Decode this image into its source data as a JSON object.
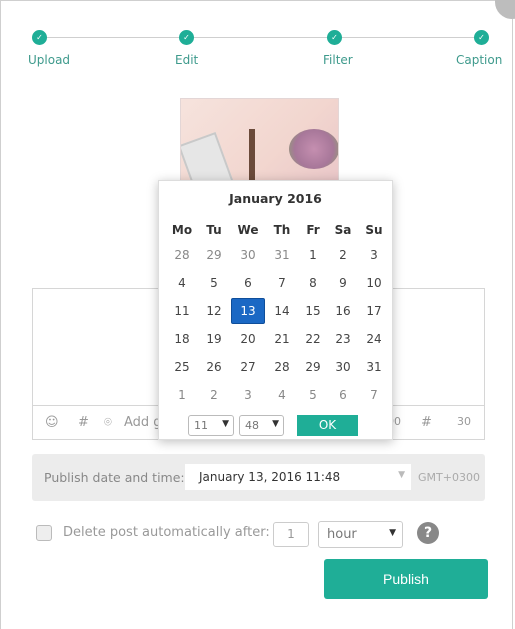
{
  "steps": [
    {
      "label": "Upload"
    },
    {
      "label": "Edit"
    },
    {
      "label": "Filter"
    },
    {
      "label": "Caption"
    }
  ],
  "toolbar": {
    "location_placeholder": "Add geo",
    "char_count": "2200",
    "hashtag_count": "30"
  },
  "calendar": {
    "title": "January 2016",
    "weekdays": [
      "Mo",
      "Tu",
      "We",
      "Th",
      "Fr",
      "Sa",
      "Su"
    ],
    "days": [
      [
        "28",
        "29",
        "30",
        "31",
        "1",
        "2",
        "3"
      ],
      [
        "4",
        "5",
        "6",
        "7",
        "8",
        "9",
        "10"
      ],
      [
        "11",
        "12",
        "13",
        "14",
        "15",
        "16",
        "17"
      ],
      [
        "18",
        "19",
        "20",
        "21",
        "22",
        "23",
        "24"
      ],
      [
        "25",
        "26",
        "27",
        "28",
        "29",
        "30",
        "31"
      ],
      [
        "1",
        "2",
        "3",
        "4",
        "5",
        "6",
        "7"
      ]
    ],
    "selected_day": "13",
    "hour": "11",
    "minute": "48",
    "ok_label": "OK"
  },
  "publish": {
    "label": "Publish date and time:",
    "value": "January 13, 2016 11:48",
    "timezone": "GMT+0300",
    "button": "Publish"
  },
  "delete": {
    "label": "Delete post automatically after:",
    "amount": "1",
    "unit": "hour",
    "help": "?"
  },
  "colors": {
    "accent": "#1fae97",
    "selected": "#1b68c4"
  }
}
